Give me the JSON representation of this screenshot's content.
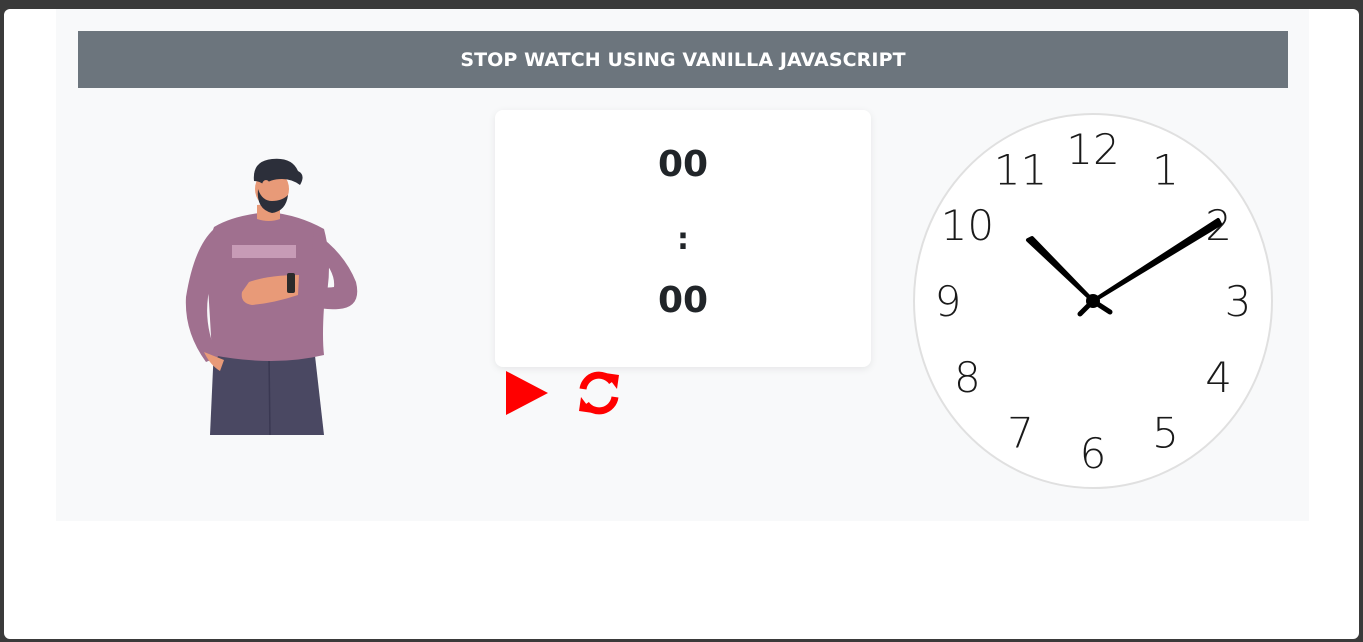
{
  "header": {
    "title": "STOP WATCH USING VANILLA JAVASCRIPT"
  },
  "timer": {
    "minutes": "00",
    "separator": ":",
    "seconds": "00"
  },
  "controls": {
    "play_icon": "play-icon",
    "reset_icon": "refresh-icon",
    "color": "#ff0000"
  },
  "clock": {
    "numerals": [
      "12",
      "1",
      "2",
      "3",
      "4",
      "5",
      "6",
      "7",
      "8",
      "9",
      "10",
      "11"
    ],
    "hour_hand_pointing": "10",
    "minute_hand_pointing": "2"
  },
  "colors": {
    "header_bg": "#6c757d",
    "page_bg": "#f8f9fa",
    "accent": "#ff0000",
    "shirt": "#a0708f",
    "pants": "#4a4862"
  }
}
